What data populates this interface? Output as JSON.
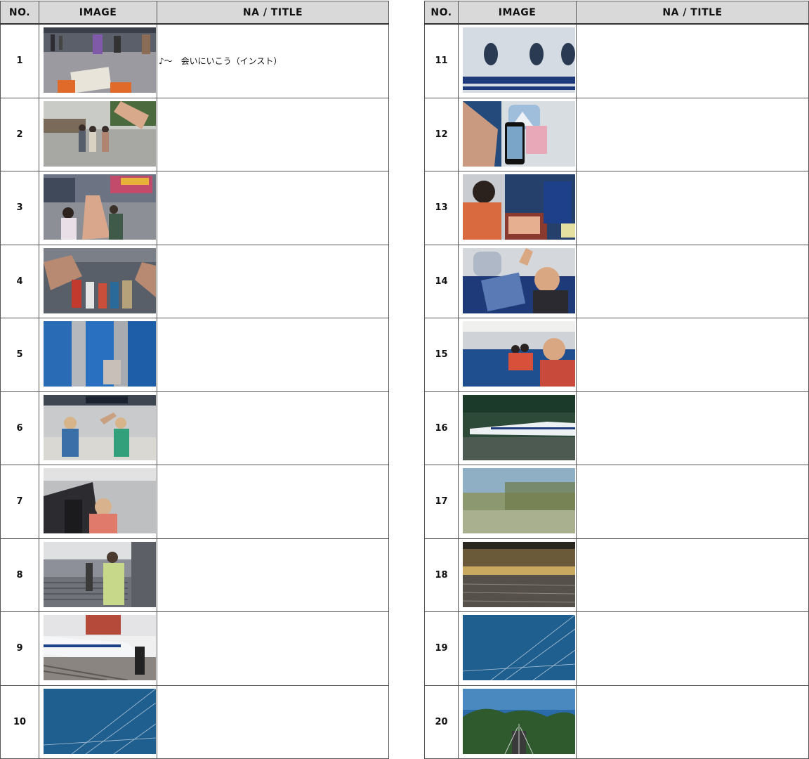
{
  "headers": {
    "no": "NO.",
    "image": "IMAGE",
    "title": "NA / TITLE"
  },
  "left_rows": [
    {
      "no": "1",
      "title": "♪～　会いにいこう（インスト）",
      "scene": "station-concourse-tickets"
    },
    {
      "no": "2",
      "title": "",
      "scene": "friends-group-outdoor"
    },
    {
      "no": "3",
      "title": "",
      "scene": "high-five-station"
    },
    {
      "no": "4",
      "title": "",
      "scene": "crowd-waving"
    },
    {
      "no": "5",
      "title": "",
      "scene": "escalator-blue"
    },
    {
      "no": "6",
      "title": "",
      "scene": "two-girls-waving-gate"
    },
    {
      "no": "7",
      "title": "",
      "scene": "girl-on-escalator"
    },
    {
      "no": "8",
      "title": "",
      "scene": "stairs-to-platform"
    },
    {
      "no": "9",
      "title": "",
      "scene": "shinkansen-platform"
    },
    {
      "no": "10",
      "title": "",
      "scene": "blue-sky-wires"
    }
  ],
  "right_rows": [
    {
      "no": "11",
      "title": "",
      "scene": "train-windows-closeup"
    },
    {
      "no": "12",
      "title": "",
      "scene": "phone-photo-mt-fuji"
    },
    {
      "no": "13",
      "title": "",
      "scene": "girl-seat-bento"
    },
    {
      "no": "14",
      "title": "",
      "scene": "boy-cheering-seat"
    },
    {
      "no": "15",
      "title": "",
      "scene": "group-selfie-carriage"
    },
    {
      "no": "16",
      "title": "",
      "scene": "shinkansen-blur-trees"
    },
    {
      "no": "17",
      "title": "",
      "scene": "motion-blur-green"
    },
    {
      "no": "18",
      "title": "",
      "scene": "motion-blur-gold"
    },
    {
      "no": "19",
      "title": "",
      "scene": "blue-sky-wires"
    },
    {
      "no": "20",
      "title": "",
      "scene": "track-view-trees"
    }
  ]
}
